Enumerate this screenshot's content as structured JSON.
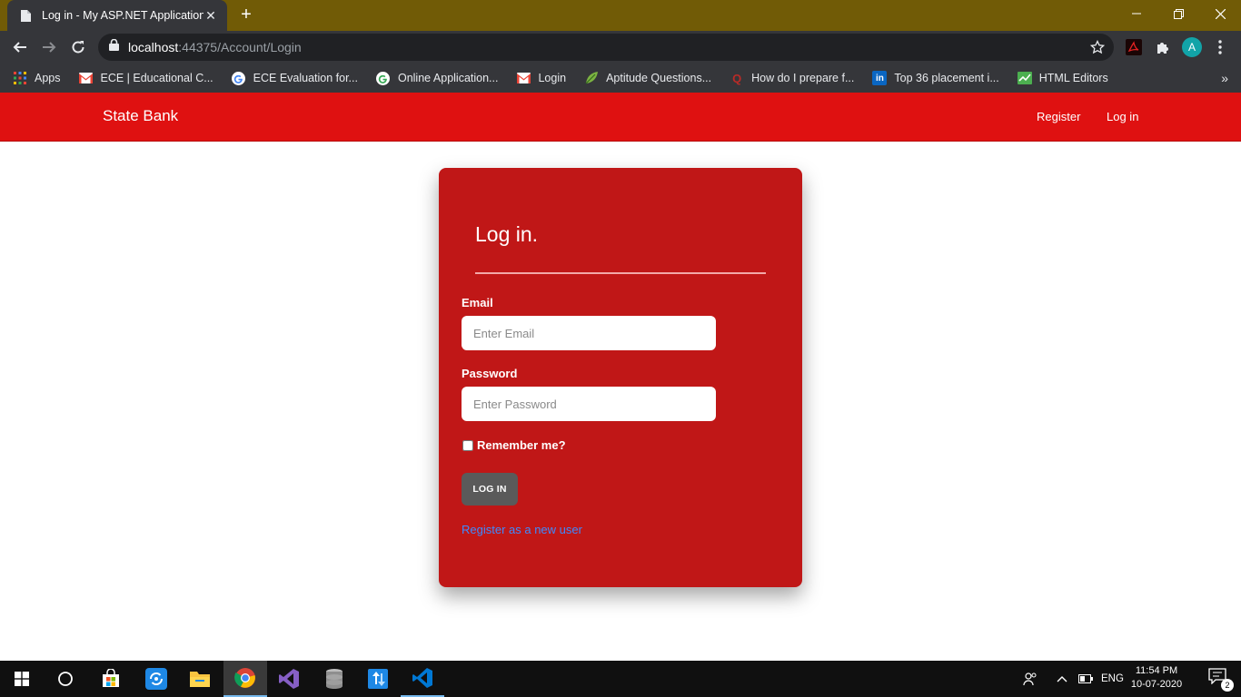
{
  "browser": {
    "tab_title": "Log in - My ASP.NET Application",
    "tab_close": "✕",
    "new_tab": "+",
    "url_host": "localhost",
    "url_path": ":44375/Account/Login",
    "avatar_letter": "A",
    "bookmarks_more": "»",
    "bookmarks": [
      {
        "label": "Apps",
        "icon": "apps-grid-icon"
      },
      {
        "label": "ECE | Educational C...",
        "icon": "gmail-icon"
      },
      {
        "label": "ECE Evaluation for...",
        "icon": "google-icon"
      },
      {
        "label": "Online Application...",
        "icon": "google-icon"
      },
      {
        "label": "Login",
        "icon": "gmail-icon"
      },
      {
        "label": "Aptitude Questions...",
        "icon": "leaf-icon"
      },
      {
        "label": "How do I prepare f...",
        "icon": "quora-icon"
      },
      {
        "label": "Top 36 placement i...",
        "icon": "linkedin-icon"
      },
      {
        "label": "HTML Editors",
        "icon": "chart-icon"
      }
    ],
    "accent_titlebar": "#715b06"
  },
  "site": {
    "brand": "State Bank",
    "nav_register": "Register",
    "nav_login": "Log in",
    "navbar_color": "#df1111"
  },
  "login": {
    "title": "Log in.",
    "email_label": "Email",
    "email_placeholder": "Enter Email",
    "email_value": "",
    "password_label": "Password",
    "password_placeholder": "Enter Password",
    "password_value": "",
    "remember_label": "Remember me?",
    "remember_checked": false,
    "submit_label": "LOG IN",
    "register_link": "Register as a new user",
    "card_color": "#c01717"
  },
  "taskbar": {
    "language": "ENG",
    "time": "11:54 PM",
    "date": "10-07-2020",
    "notification_count": "2"
  }
}
